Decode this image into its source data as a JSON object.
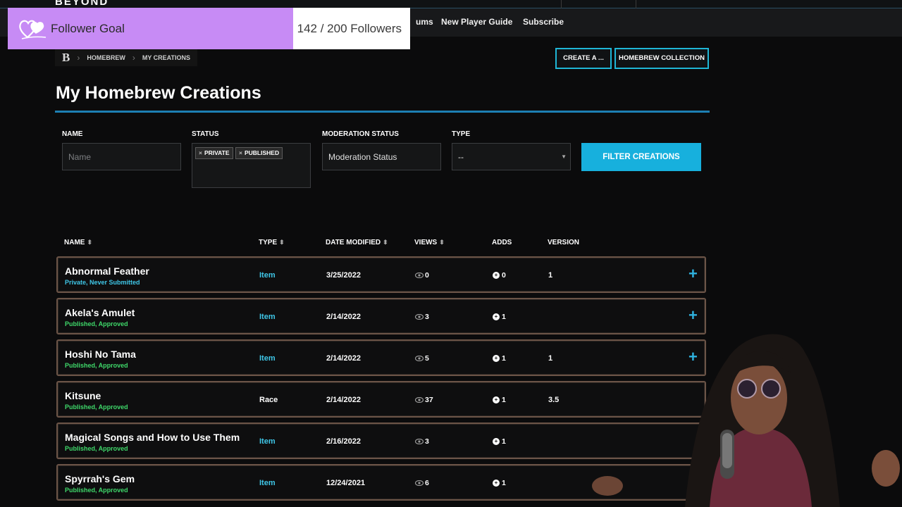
{
  "brand": {
    "logo_fragment": "BEYOND",
    "logo_letter": "B"
  },
  "nav": {
    "items": [
      "ums",
      "New Player Guide",
      "Subscribe"
    ]
  },
  "follower_goal": {
    "label": "Follower Goal",
    "current": 142,
    "goal": 200,
    "count_text": "142 / 200 Followers",
    "progress": 0.71,
    "fill_color": "#c78bf5"
  },
  "breadcrumb": {
    "items": [
      "HOMEBREW",
      "MY CREATIONS"
    ]
  },
  "actions": {
    "create": "CREATE A ...",
    "collection": "HOMEBREW COLLECTION"
  },
  "page": {
    "title": "My Homebrew Creations"
  },
  "filters": {
    "name_label": "NAME",
    "name_placeholder": "Name",
    "status_label": "STATUS",
    "status_tags": [
      "PRIVATE",
      "PUBLISHED"
    ],
    "moderation_label": "MODERATION STATUS",
    "moderation_value": "Moderation Status",
    "type_label": "TYPE",
    "type_value": "--",
    "filter_button": "FILTER CREATIONS"
  },
  "table": {
    "headers": [
      "NAME",
      "TYPE",
      "DATE MODIFIED",
      "VIEWS",
      "ADDS",
      "VERSION"
    ],
    "rows": [
      {
        "name": "Abnormal Feather",
        "status": "Private, Never Submitted",
        "type": "Item",
        "date": "3/25/2022",
        "views": "0",
        "adds": "0",
        "version": "1",
        "plus": "+"
      },
      {
        "name": "Akela's Amulet",
        "status": "Published, Approved",
        "type": "Item",
        "date": "2/14/2022",
        "views": "3",
        "adds": "1",
        "version": "",
        "plus": "+"
      },
      {
        "name": "Hoshi No Tama",
        "status": "Published, Approved",
        "type": "Item",
        "date": "2/14/2022",
        "views": "5",
        "adds": "1",
        "version": "1",
        "plus": "+"
      },
      {
        "name": "Kitsune",
        "status": "Published, Approved",
        "type": "Race",
        "date": "2/14/2022",
        "views": "37",
        "adds": "1",
        "version": "3.5",
        "plus": ""
      },
      {
        "name": "Magical Songs and How to Use Them",
        "status": "Published, Approved",
        "type": "Item",
        "date": "2/16/2022",
        "views": "3",
        "adds": "1",
        "version": "",
        "plus": ""
      },
      {
        "name": "Spyrrah's Gem",
        "status": "Published, Approved",
        "type": "Item",
        "date": "12/24/2021",
        "views": "6",
        "adds": "1",
        "version": "",
        "plus": ""
      }
    ]
  },
  "colors": {
    "accent": "#1fb6d6",
    "status_green": "#3fd86a",
    "type_cyan": "#3fc7e8",
    "row_border": "#6b5447"
  }
}
